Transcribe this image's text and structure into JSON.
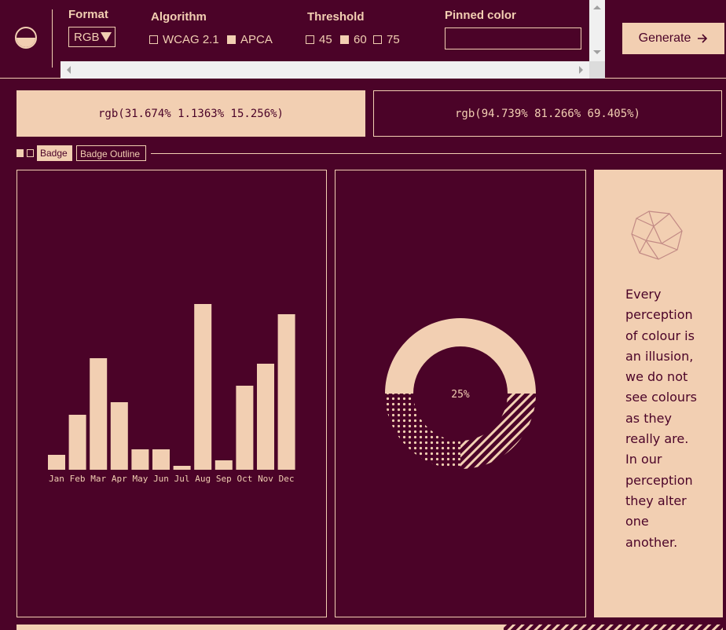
{
  "toolbar": {
    "logo_icon": "half-circle-icon",
    "format": {
      "title": "Format",
      "selected": "RGB"
    },
    "algorithm": {
      "title": "Algorithm",
      "options": [
        {
          "label": "WCAG 2.1",
          "checked": false
        },
        {
          "label": "APCA",
          "checked": true
        }
      ]
    },
    "threshold": {
      "title": "Threshold",
      "options": [
        {
          "label": "45",
          "checked": false
        },
        {
          "label": "60",
          "checked": true
        },
        {
          "label": "75",
          "checked": false
        }
      ]
    },
    "pinned": {
      "title": "Pinned color",
      "value": ""
    },
    "generate_label": "Generate",
    "generate_icon": "arrow-right-icon"
  },
  "swatches": {
    "primary": "rgb(31.674% 1.1363% 15.256%)",
    "secondary": "rgb(94.739% 81.266% 69.405%)"
  },
  "badges": {
    "fill_label": "Badge",
    "outline_label": "Badge Outline"
  },
  "colors": {
    "background": "#4b0328",
    "foreground": "#f2cfb2"
  },
  "chart_data": [
    {
      "type": "bar",
      "categories": [
        "Jan",
        "Feb",
        "Mar",
        "Apr",
        "May",
        "Jun",
        "Jul",
        "Aug",
        "Sep",
        "Oct",
        "Nov",
        "Dec"
      ],
      "values": [
        19,
        70,
        142,
        86,
        26,
        26,
        5,
        211,
        12,
        107,
        135,
        198
      ],
      "title": "",
      "xlabel": "",
      "ylabel": ""
    },
    {
      "type": "pie",
      "label": "25%",
      "slices": [
        {
          "value": 50,
          "fill": "solid"
        },
        {
          "value": 25,
          "fill": "hatched"
        },
        {
          "value": 25,
          "fill": "dotted"
        }
      ]
    }
  ],
  "quote": {
    "text": "Every perception of colour is an illusion, we do not see colours as they really are. In our perception they alter one another.",
    "icon": "polyhedron-icon"
  }
}
